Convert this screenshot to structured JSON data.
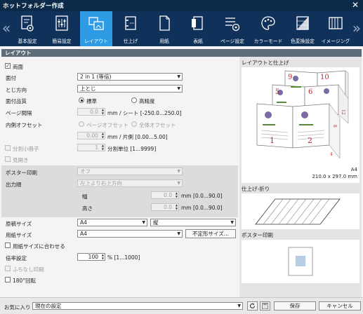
{
  "window": {
    "title": "ホットフォルダー作成",
    "close_glyph": "✕"
  },
  "tabs": [
    {
      "label": "基本設定",
      "icon": "basic-settings-icon"
    },
    {
      "label": "簡易設定",
      "icon": "simple-settings-icon"
    },
    {
      "label": "レイアウト",
      "icon": "layout-icon",
      "active": true
    },
    {
      "label": "仕上げ",
      "icon": "finishing-icon"
    },
    {
      "label": "用紙",
      "icon": "paper-icon"
    },
    {
      "label": "表紙",
      "icon": "cover-icon"
    },
    {
      "label": "ページ設定",
      "icon": "page-settings-icon"
    },
    {
      "label": "カラーモード",
      "icon": "color-mode-icon"
    },
    {
      "label": "色変換設定",
      "icon": "color-conversion-icon"
    },
    {
      "label": "イメージング",
      "icon": "imaging-icon"
    }
  ],
  "section_title": "レイアウト",
  "form": {
    "duplex": {
      "label": "両面",
      "checked": true,
      "glyph": "✓"
    },
    "imposition": {
      "label": "面付",
      "value": "2 in 1 (等倍)"
    },
    "binding": {
      "label": "とじ方向",
      "value": "上とじ"
    },
    "quality": {
      "label": "面付品質",
      "option1": "標準",
      "option2": "高精度",
      "selected": "標準"
    },
    "page_gap": {
      "label": "ページ間隔",
      "value": "0.0",
      "unit": "mm / シート [-250.0...250.0]"
    },
    "inner_offset": {
      "label": "内側オフセット",
      "opt_page": "ページオフセット",
      "opt_all": "全体オフセット",
      "value": "0.00",
      "unit": "mm / 片側 [0.00...5.00]"
    },
    "split_booklet": {
      "label": "分割小冊子",
      "value": "1",
      "unit": "分割単位 [1...9999]"
    },
    "spread": {
      "label": "見開き"
    },
    "poster": {
      "label": "ポスター印刷",
      "value": "オフ"
    },
    "output_order": {
      "label": "出力順",
      "value": "左上より右上方向"
    },
    "width": {
      "label": "幅",
      "value": "0.0",
      "unit": "mm [0.0...90.0]"
    },
    "height": {
      "label": "高さ",
      "value": "0.0",
      "unit": "mm [0.0...90.0]"
    },
    "original_size": {
      "label": "原稿サイズ",
      "value": "A4",
      "orientation": "縦"
    },
    "paper_size": {
      "label": "用紙サイズ",
      "value": "A4",
      "custom_button": "不定形サイズ..."
    },
    "fit_paper": {
      "label": "用紙サイズに合わせる"
    },
    "scale": {
      "label": "倍率設定",
      "value": "100",
      "unit": "% [1...1000]"
    },
    "borderless": {
      "label": "ふちなし印刷"
    },
    "rotate180": {
      "label": "180°回転"
    }
  },
  "preview": {
    "layout_title": "レイアウトと仕上げ",
    "page_numbers": [
      "9",
      "10",
      "5",
      "6",
      "1",
      "2",
      "12",
      "8",
      "4"
    ],
    "paper_name": "A4",
    "paper_dims": "210.0 x 297.0 mm",
    "fold_title": "仕上げ-折り",
    "poster_title": "ポスター印刷"
  },
  "footer": {
    "favorites_label": "お気に入り",
    "favorites_value": "現在の設定",
    "save_button": "保存",
    "cancel_button": "キャンセル"
  },
  "colors": {
    "title_bg": "#0c2a4a",
    "tab_bg": "#10315a",
    "active_tab": "#2f9be4",
    "section_header": "#5e6c7a",
    "page_number_red": "#c0282d"
  }
}
